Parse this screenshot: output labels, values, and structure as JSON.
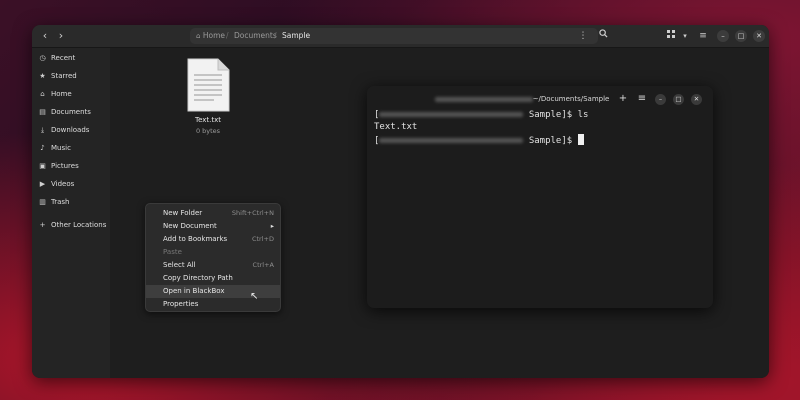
{
  "files": {
    "headerbar": {
      "back_icon": "chevron-left-icon",
      "forward_icon": "chevron-right-icon",
      "breadcrumbs": [
        "Home",
        "Documents",
        "Sample"
      ],
      "icons": [
        "more-vertical-icon",
        "search-icon",
        "grid-view-icon",
        "view-options-chevron-icon",
        "hamburger-menu-icon"
      ]
    },
    "sidebar": {
      "items": [
        {
          "label": "Recent",
          "icon": "clock-icon"
        },
        {
          "label": "Starred",
          "icon": "star-icon"
        },
        {
          "label": "Home",
          "icon": "home-icon"
        },
        {
          "label": "Documents",
          "icon": "document-icon"
        },
        {
          "label": "Downloads",
          "icon": "download-icon"
        },
        {
          "label": "Music",
          "icon": "music-icon"
        },
        {
          "label": "Pictures",
          "icon": "picture-icon"
        },
        {
          "label": "Videos",
          "icon": "video-icon"
        },
        {
          "label": "Trash",
          "icon": "trash-icon"
        },
        {
          "label": "Other Locations",
          "icon": "plus-icon"
        }
      ]
    },
    "file": {
      "name": "Text.txt",
      "size": "0 bytes",
      "icon": "text-file-icon"
    }
  },
  "context_menu": {
    "items": [
      {
        "label": "New Folder",
        "shortcut": "Shift+Ctrl+N"
      },
      {
        "label": "New Document",
        "shortcut": "",
        "submenu": true
      },
      {
        "label": "Add to Bookmarks",
        "shortcut": "Ctrl+D"
      },
      {
        "label": "Paste",
        "shortcut": "",
        "disabled": true
      },
      {
        "label": "Select All",
        "shortcut": "Ctrl+A"
      },
      {
        "label": "Copy Directory Path",
        "shortcut": ""
      },
      {
        "label": "Open in BlackBox",
        "shortcut": "",
        "hovered": true
      },
      {
        "label": "Properties",
        "shortcut": ""
      }
    ]
  },
  "terminal": {
    "title": "~/Documents/Sample",
    "lines": [
      {
        "prefix": "[",
        "suffix": " Sample]$ ls"
      },
      {
        "text": "Text.txt"
      },
      {
        "prefix": "[",
        "suffix": " Sample]$ "
      }
    ]
  },
  "colors": {
    "accent": "#3e3e3e",
    "window_bg": "#1e1e1e",
    "sidebar_bg": "#242424"
  }
}
